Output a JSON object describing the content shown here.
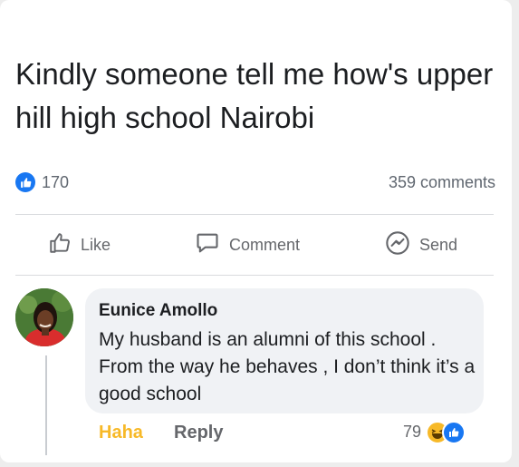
{
  "post": {
    "title": "Kindly someone tell me how's upper hill high school Nairobi",
    "likes_count": "170",
    "comments_count": "359 comments"
  },
  "actions": {
    "like_label": "Like",
    "comment_label": "Comment",
    "send_label": "Send"
  },
  "comment": {
    "author": "Eunice Amollo",
    "text": "My husband is an alumni of this school . From the way he behaves , I don’t think it’s a good school",
    "haha_label": "Haha",
    "reply_label": "Reply",
    "reaction_count": "79"
  },
  "colors": {
    "brand_blue": "#1877f2",
    "haha_yellow": "#f7b928",
    "text_gray": "#65676b"
  },
  "icons": [
    "like-icon",
    "comment-icon",
    "messenger-icon",
    "haha-reaction-icon",
    "like-reaction-icon"
  ]
}
